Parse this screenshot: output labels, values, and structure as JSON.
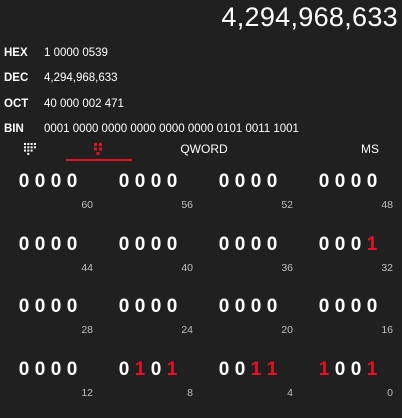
{
  "display": {
    "value": "4,294,968,633"
  },
  "radix": [
    {
      "label": "HEX",
      "value": "1 0000 0539"
    },
    {
      "label": "DEC",
      "value": "4,294,968,633"
    },
    {
      "label": "OCT",
      "value": "40 000 002 471"
    },
    {
      "label": "BIN",
      "value": "0001 0000 0000 0000 0000 0000 0101 0011 1001"
    }
  ],
  "toolbar": {
    "keypad_icon": "keypad-icon",
    "bit_toggle_icon": "bit-toggle-icon",
    "word_size": "QWORD",
    "memory_store": "MS"
  },
  "colors": {
    "background": "#202020",
    "accent": "#e81123",
    "text": "#ffffff",
    "muted": "#bfbfbf"
  },
  "bit_rows": [
    {
      "nibbles": [
        {
          "bits": [
            "0",
            "0",
            "0",
            "0"
          ],
          "label": "60"
        },
        {
          "bits": [
            "0",
            "0",
            "0",
            "0"
          ],
          "label": "56"
        },
        {
          "bits": [
            "0",
            "0",
            "0",
            "0"
          ],
          "label": "52"
        },
        {
          "bits": [
            "0",
            "0",
            "0",
            "0"
          ],
          "label": "48"
        }
      ]
    },
    {
      "nibbles": [
        {
          "bits": [
            "0",
            "0",
            "0",
            "0"
          ],
          "label": "44"
        },
        {
          "bits": [
            "0",
            "0",
            "0",
            "0"
          ],
          "label": "40"
        },
        {
          "bits": [
            "0",
            "0",
            "0",
            "0"
          ],
          "label": "36"
        },
        {
          "bits": [
            "0",
            "0",
            "0",
            "1"
          ],
          "label": "32"
        }
      ]
    },
    {
      "nibbles": [
        {
          "bits": [
            "0",
            "0",
            "0",
            "0"
          ],
          "label": "28"
        },
        {
          "bits": [
            "0",
            "0",
            "0",
            "0"
          ],
          "label": "24"
        },
        {
          "bits": [
            "0",
            "0",
            "0",
            "0"
          ],
          "label": "20"
        },
        {
          "bits": [
            "0",
            "0",
            "0",
            "0"
          ],
          "label": "16"
        }
      ]
    },
    {
      "nibbles": [
        {
          "bits": [
            "0",
            "0",
            "0",
            "0"
          ],
          "label": "12"
        },
        {
          "bits": [
            "0",
            "1",
            "0",
            "1"
          ],
          "label": "8"
        },
        {
          "bits": [
            "0",
            "0",
            "1",
            "1"
          ],
          "label": "4"
        },
        {
          "bits": [
            "1",
            "0",
            "0",
            "1"
          ],
          "label": "0"
        }
      ]
    }
  ]
}
